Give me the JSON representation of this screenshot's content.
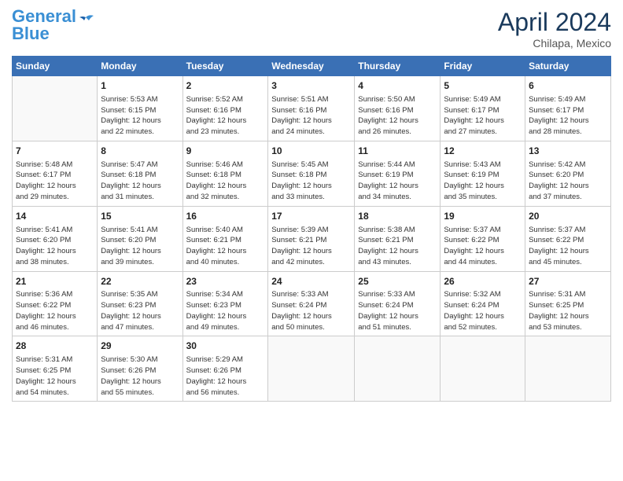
{
  "header": {
    "logo_line1": "General",
    "logo_line2": "Blue",
    "month": "April 2024",
    "location": "Chilapa, Mexico"
  },
  "days_of_week": [
    "Sunday",
    "Monday",
    "Tuesday",
    "Wednesday",
    "Thursday",
    "Friday",
    "Saturday"
  ],
  "weeks": [
    [
      {
        "day": "",
        "info": ""
      },
      {
        "day": "1",
        "info": "Sunrise: 5:53 AM\nSunset: 6:15 PM\nDaylight: 12 hours\nand 22 minutes."
      },
      {
        "day": "2",
        "info": "Sunrise: 5:52 AM\nSunset: 6:16 PM\nDaylight: 12 hours\nand 23 minutes."
      },
      {
        "day": "3",
        "info": "Sunrise: 5:51 AM\nSunset: 6:16 PM\nDaylight: 12 hours\nand 24 minutes."
      },
      {
        "day": "4",
        "info": "Sunrise: 5:50 AM\nSunset: 6:16 PM\nDaylight: 12 hours\nand 26 minutes."
      },
      {
        "day": "5",
        "info": "Sunrise: 5:49 AM\nSunset: 6:17 PM\nDaylight: 12 hours\nand 27 minutes."
      },
      {
        "day": "6",
        "info": "Sunrise: 5:49 AM\nSunset: 6:17 PM\nDaylight: 12 hours\nand 28 minutes."
      }
    ],
    [
      {
        "day": "7",
        "info": "Sunrise: 5:48 AM\nSunset: 6:17 PM\nDaylight: 12 hours\nand 29 minutes."
      },
      {
        "day": "8",
        "info": "Sunrise: 5:47 AM\nSunset: 6:18 PM\nDaylight: 12 hours\nand 31 minutes."
      },
      {
        "day": "9",
        "info": "Sunrise: 5:46 AM\nSunset: 6:18 PM\nDaylight: 12 hours\nand 32 minutes."
      },
      {
        "day": "10",
        "info": "Sunrise: 5:45 AM\nSunset: 6:18 PM\nDaylight: 12 hours\nand 33 minutes."
      },
      {
        "day": "11",
        "info": "Sunrise: 5:44 AM\nSunset: 6:19 PM\nDaylight: 12 hours\nand 34 minutes."
      },
      {
        "day": "12",
        "info": "Sunrise: 5:43 AM\nSunset: 6:19 PM\nDaylight: 12 hours\nand 35 minutes."
      },
      {
        "day": "13",
        "info": "Sunrise: 5:42 AM\nSunset: 6:20 PM\nDaylight: 12 hours\nand 37 minutes."
      }
    ],
    [
      {
        "day": "14",
        "info": "Sunrise: 5:41 AM\nSunset: 6:20 PM\nDaylight: 12 hours\nand 38 minutes."
      },
      {
        "day": "15",
        "info": "Sunrise: 5:41 AM\nSunset: 6:20 PM\nDaylight: 12 hours\nand 39 minutes."
      },
      {
        "day": "16",
        "info": "Sunrise: 5:40 AM\nSunset: 6:21 PM\nDaylight: 12 hours\nand 40 minutes."
      },
      {
        "day": "17",
        "info": "Sunrise: 5:39 AM\nSunset: 6:21 PM\nDaylight: 12 hours\nand 42 minutes."
      },
      {
        "day": "18",
        "info": "Sunrise: 5:38 AM\nSunset: 6:21 PM\nDaylight: 12 hours\nand 43 minutes."
      },
      {
        "day": "19",
        "info": "Sunrise: 5:37 AM\nSunset: 6:22 PM\nDaylight: 12 hours\nand 44 minutes."
      },
      {
        "day": "20",
        "info": "Sunrise: 5:37 AM\nSunset: 6:22 PM\nDaylight: 12 hours\nand 45 minutes."
      }
    ],
    [
      {
        "day": "21",
        "info": "Sunrise: 5:36 AM\nSunset: 6:22 PM\nDaylight: 12 hours\nand 46 minutes."
      },
      {
        "day": "22",
        "info": "Sunrise: 5:35 AM\nSunset: 6:23 PM\nDaylight: 12 hours\nand 47 minutes."
      },
      {
        "day": "23",
        "info": "Sunrise: 5:34 AM\nSunset: 6:23 PM\nDaylight: 12 hours\nand 49 minutes."
      },
      {
        "day": "24",
        "info": "Sunrise: 5:33 AM\nSunset: 6:24 PM\nDaylight: 12 hours\nand 50 minutes."
      },
      {
        "day": "25",
        "info": "Sunrise: 5:33 AM\nSunset: 6:24 PM\nDaylight: 12 hours\nand 51 minutes."
      },
      {
        "day": "26",
        "info": "Sunrise: 5:32 AM\nSunset: 6:24 PM\nDaylight: 12 hours\nand 52 minutes."
      },
      {
        "day": "27",
        "info": "Sunrise: 5:31 AM\nSunset: 6:25 PM\nDaylight: 12 hours\nand 53 minutes."
      }
    ],
    [
      {
        "day": "28",
        "info": "Sunrise: 5:31 AM\nSunset: 6:25 PM\nDaylight: 12 hours\nand 54 minutes."
      },
      {
        "day": "29",
        "info": "Sunrise: 5:30 AM\nSunset: 6:26 PM\nDaylight: 12 hours\nand 55 minutes."
      },
      {
        "day": "30",
        "info": "Sunrise: 5:29 AM\nSunset: 6:26 PM\nDaylight: 12 hours\nand 56 minutes."
      },
      {
        "day": "",
        "info": ""
      },
      {
        "day": "",
        "info": ""
      },
      {
        "day": "",
        "info": ""
      },
      {
        "day": "",
        "info": ""
      }
    ]
  ]
}
